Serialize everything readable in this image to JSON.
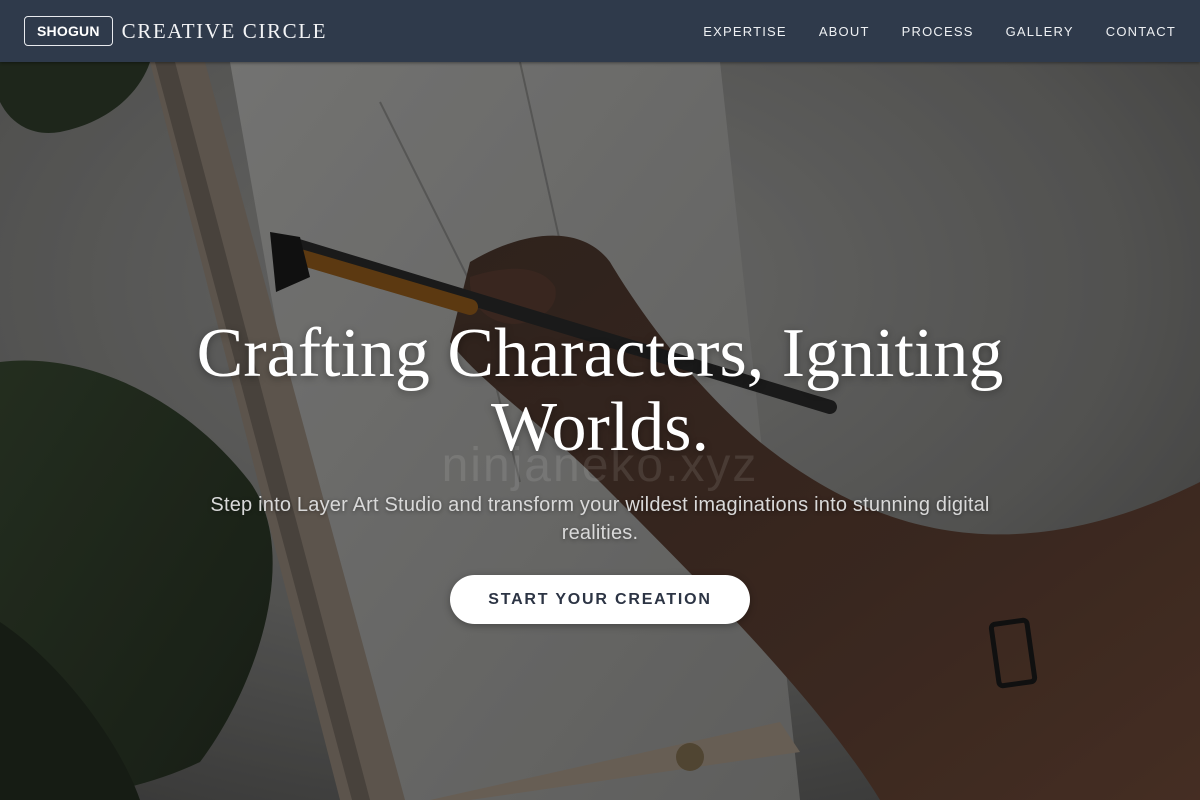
{
  "brand": {
    "badge": "SHOGUN",
    "name": "CREATIVE CIRCLE"
  },
  "nav": {
    "items": [
      {
        "label": "EXPERTISE"
      },
      {
        "label": "ABOUT"
      },
      {
        "label": "PROCESS"
      },
      {
        "label": "GALLERY"
      },
      {
        "label": "CONTACT"
      }
    ]
  },
  "hero": {
    "headline": "Crafting Characters, Igniting Worlds.",
    "watermark": "ninjaneko.xyz",
    "subtext": "Step into Layer Art Studio and transform your wildest imaginations into stunning digital realities.",
    "cta_label": "START YOUR CREATION"
  },
  "colors": {
    "nav_bg": "#2f3a4b",
    "cta_bg": "#ffffff",
    "cta_text": "#2c3444"
  }
}
